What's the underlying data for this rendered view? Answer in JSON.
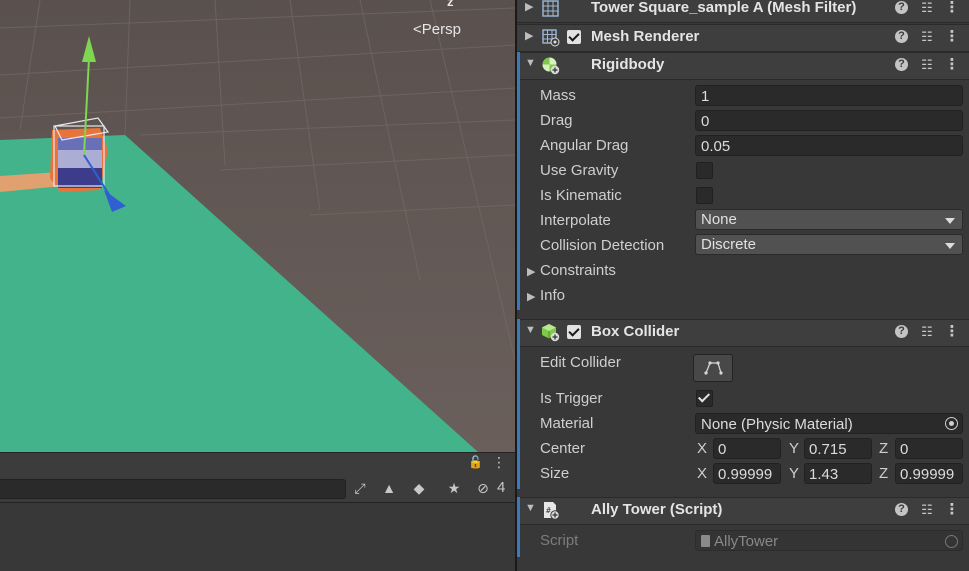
{
  "scene": {
    "projection_label": "Persp",
    "axis_label": "z"
  },
  "bottom_panel": {
    "hidden_count": "4"
  },
  "inspector": {
    "components": {
      "mesh_filter": {
        "title": "Tower Square_sample A (Mesh Filter)"
      },
      "mesh_renderer": {
        "title": "Mesh Renderer",
        "enabled": true
      },
      "rigidbody": {
        "title": "Rigidbody",
        "mass_label": "Mass",
        "mass": "1",
        "drag_label": "Drag",
        "drag": "0",
        "angular_drag_label": "Angular Drag",
        "angular_drag": "0.05",
        "use_gravity_label": "Use Gravity",
        "use_gravity": false,
        "is_kinematic_label": "Is Kinematic",
        "is_kinematic": false,
        "interpolate_label": "Interpolate",
        "interpolate": "None",
        "collision_detection_label": "Collision Detection",
        "collision_detection": "Discrete",
        "constraints_label": "Constraints",
        "info_label": "Info"
      },
      "box_collider": {
        "title": "Box Collider",
        "enabled": true,
        "edit_collider_label": "Edit Collider",
        "is_trigger_label": "Is Trigger",
        "is_trigger": true,
        "material_label": "Material",
        "material": "None (Physic Material)",
        "center_label": "Center",
        "center": {
          "x_label": "X",
          "x": "0",
          "y_label": "Y",
          "y": "0.715",
          "z_label": "Z",
          "z": "0"
        },
        "size_label": "Size",
        "size": {
          "x_label": "X",
          "x": "0.99999",
          "y_label": "Y",
          "y": "1.43",
          "z_label": "Z",
          "z": "0.99999"
        }
      },
      "ally_tower": {
        "title": "Ally Tower (Script)",
        "script_label": "Script",
        "script": "AllyTower"
      }
    }
  },
  "colors": {
    "accent": "#3a79bb",
    "ground": "#43b38c",
    "background": "#5e5451"
  }
}
